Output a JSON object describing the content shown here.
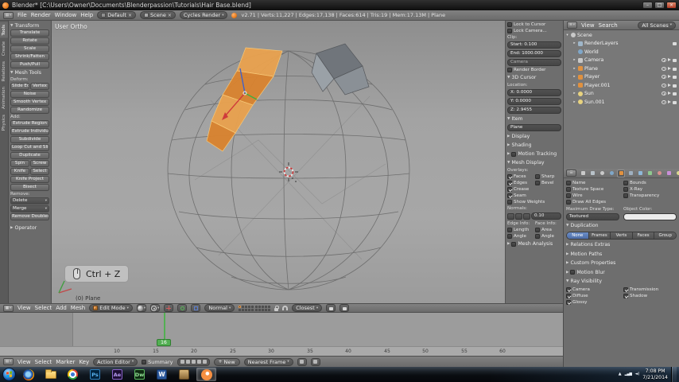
{
  "titlebar": {
    "title": "Blender* [C:\\Users\\Owner\\Documents\\Blenderpassion\\Tutorials\\Hair Base.blend]"
  },
  "info_bar": {
    "menus": [
      "File",
      "Render",
      "Window",
      "Help"
    ],
    "layout_name": "Default",
    "scene_name": "Scene",
    "engine": "Cycles Render",
    "stats": "v2.71 | Verts:11,227 | Edges:17,138 | Faces:614 | Tris:19 | Mem:17.13M | Plane"
  },
  "tool_shelf": {
    "tabs": [
      "Tools",
      "Create",
      "Relations",
      "Animation",
      "Physics"
    ],
    "transform_title": "Transform",
    "transform_buttons": [
      "Translate",
      "Rotate",
      "Scale",
      "Shrink/Fatten",
      "Push/Pull"
    ],
    "mesh_tools_title": "Mesh Tools",
    "deform_label": "Deform:",
    "deform_split": [
      "Slide Ed",
      "Vertex"
    ],
    "deform_buttons": [
      "Noise",
      "Smooth Vertex",
      "Randomize"
    ],
    "add_label": "Add:",
    "add_buttons": [
      "Extrude Region",
      "Extrude Individual",
      "Subdivide",
      "Loop Cut and Slide",
      "Duplicate"
    ],
    "add_split1": [
      "Spin",
      "Screw"
    ],
    "add_split2": [
      "Knife",
      "Select"
    ],
    "add_buttons2": [
      "Knife Project",
      "Bisect"
    ],
    "remove_label": "Remove:",
    "remove_buttons": [
      "Delete",
      "Merge",
      "Remove Doubles"
    ],
    "operator_title": "Operator"
  },
  "viewport": {
    "view_label": "User Ortho",
    "object_label": "(0) Plane",
    "screencast_key": "Ctrl + Z"
  },
  "view3d_header": {
    "menus": [
      "View",
      "Select",
      "Add",
      "Mesh"
    ],
    "mode": "Edit Mode",
    "orientation": "Normal",
    "snap_target": "Closest"
  },
  "n_panel": {
    "lock_to_cursor": "Lock to Cursor",
    "lock_camera": "Lock Camera...",
    "clip_label": "Clip:",
    "clip_start": "Start: 0.100",
    "clip_end": "End: 1000.000",
    "camera_value": "Camera",
    "render_border": "Render Border",
    "cursor_panel": "3D Cursor",
    "location_label": "Location:",
    "loc_x": "X: 0.0000",
    "loc_y": "Y: 0.0000",
    "loc_z": "Z: 2.9455",
    "item_panel": "Item",
    "item_name": "Plane",
    "display_panel": "Display",
    "shading_panel": "Shading",
    "motion_tracking_panel": "Motion Tracking",
    "mesh_display_panel": "Mesh Display",
    "overlays_label": "Overlays:",
    "overlays": [
      "Faces",
      "Sharp",
      "Edges",
      "Bevel",
      "Crease",
      "Seam",
      "Show Weights"
    ],
    "normals_label": "Normals:",
    "normals_size": "0.10",
    "edge_info_label": "Edge Info:",
    "face_info_label": "Face Info:",
    "edge_checks": [
      "Length",
      "Angle"
    ],
    "face_checks": [
      "Area",
      "Angle"
    ],
    "mesh_analysis_panel": "Mesh Analysis"
  },
  "outliner": {
    "menu_view": "View",
    "menu_search": "Search",
    "display_mode": "All Scenes",
    "items": [
      {
        "label": "Scene"
      },
      {
        "label": "RenderLayers"
      },
      {
        "label": "World"
      },
      {
        "label": "Camera"
      },
      {
        "label": "Plane"
      },
      {
        "label": "Player"
      },
      {
        "label": "Player.001"
      },
      {
        "label": "Sun"
      },
      {
        "label": "Sun.001"
      }
    ]
  },
  "properties": {
    "display_checks_left": [
      "Name",
      "Texture Space",
      "Wire",
      "Draw All Edges"
    ],
    "display_checks_right": [
      "Bounds",
      "X-Ray",
      "Transparency"
    ],
    "max_draw_label": "Maximum Draw Type:",
    "max_draw_value": "Textured",
    "object_color_label": "Object Color:",
    "duplication_title": "Duplication",
    "duplication_options": [
      "None",
      "Frames",
      "Verts",
      "Faces",
      "Group"
    ],
    "panel_relations": "Relations Extras",
    "panel_motion_paths": "Motion Paths",
    "panel_custom_props": "Custom Properties",
    "panel_motion_blur": "Motion Blur",
    "ray_visibility_title": "Ray Visibility",
    "ray_checks_left": [
      "Camera",
      "Diffuse",
      "Glossy"
    ],
    "ray_checks_right": [
      "Transmission",
      "Shadow"
    ]
  },
  "dopesheet": {
    "ruler_labels": [
      "10",
      "15",
      "20",
      "25",
      "30",
      "35",
      "40",
      "45",
      "50",
      "55",
      "60"
    ],
    "current_frame": "16",
    "menus": [
      "View",
      "Select",
      "Marker",
      "Key"
    ],
    "mode": "Action Editor",
    "summary_label": "Summary",
    "new_button": "New",
    "snap_mode": "Nearest Frame"
  },
  "taskbar": {
    "ps": "Ps",
    "ae": "Ae",
    "dw": "Dw",
    "word": "W",
    "time": "7:08 PM",
    "date": "7/21/2014"
  },
  "colors": {
    "selection_orange": "#e9953f",
    "playhead_green": "#53af53",
    "accent_blue": "#5b80bf"
  }
}
